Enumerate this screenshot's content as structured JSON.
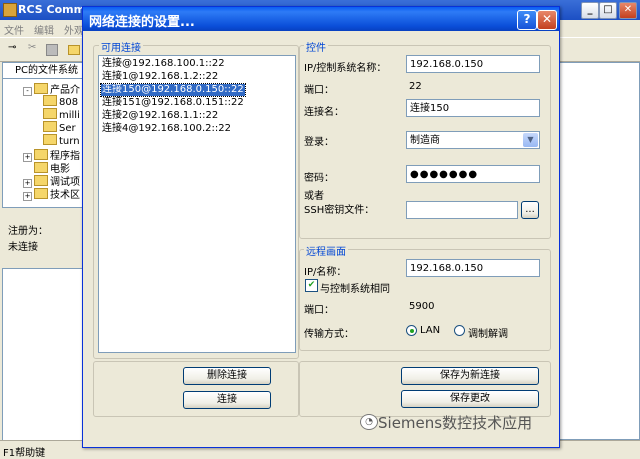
{
  "app": {
    "title": "RCS Comman",
    "menu": [
      "文件",
      "编辑",
      "外观"
    ],
    "panel_tab": "PC的文件系统",
    "tree": [
      {
        "label": "产品介",
        "level": 0,
        "expander": "-"
      },
      {
        "label": "808",
        "level": 1
      },
      {
        "label": "milli",
        "level": 1
      },
      {
        "label": "Ser",
        "level": 1
      },
      {
        "label": "turn",
        "level": 1
      },
      {
        "label": "程序指",
        "level": 0,
        "expander": "+"
      },
      {
        "label": "电影",
        "level": 0,
        "expander": ""
      },
      {
        "label": "调试项",
        "level": 0,
        "expander": "+"
      },
      {
        "label": "技术区",
        "level": 0,
        "expander": "+"
      }
    ],
    "registered_label": "注册为：",
    "registered_value": "未连接",
    "status_left": "F1帮助键"
  },
  "dialog": {
    "title": "网络连接的设置...",
    "help": "?",
    "close": "✕",
    "available_group": "可用连接",
    "connections": [
      "连接@192.168.100.1::22",
      "连接1@192.168.1.2::22",
      "连接150@192.168.0.150::22",
      "连接151@192.168.0.151::22",
      "连接2@192.168.1.1::22",
      "连接4@192.168.100.2::22"
    ],
    "selected_index": 2,
    "delete_button": "删除连接",
    "connect_button": "连接",
    "control_group": "控件",
    "ip_label": "IP/控制系统名称：",
    "ip_value": "192.168.0.150",
    "port_label": "端口：",
    "port_value": "22",
    "conn_name_label": "连接名：",
    "conn_name_value": "连接150",
    "login_label": "登录：",
    "login_value": "制造商",
    "password_label": "密码：",
    "password_value": "●●●●●●●",
    "or_label": "或者",
    "ssh_label": "SSH密钥文件：",
    "ssh_value": "",
    "browse_button": "...",
    "remote_group": "远程画面",
    "remote_ip_label": "IP/名称：",
    "remote_ip_value": "192.168.0.150",
    "same_as_control_label": "与控制系统相同",
    "same_as_control_checked": true,
    "remote_port_label": "端口：",
    "remote_port_value": "5900",
    "transfer_label": "传输方式：",
    "transfer_lan": "LAN",
    "transfer_modem": "调制解调",
    "save_new_button": "保存为新连接",
    "save_changes_button": "保存更改",
    "colors": {
      "title_bar": "#0a4ed9",
      "group_label": "#0046d5",
      "selection": "#316ac5"
    }
  },
  "watermark": "Siemens数控技术应用"
}
